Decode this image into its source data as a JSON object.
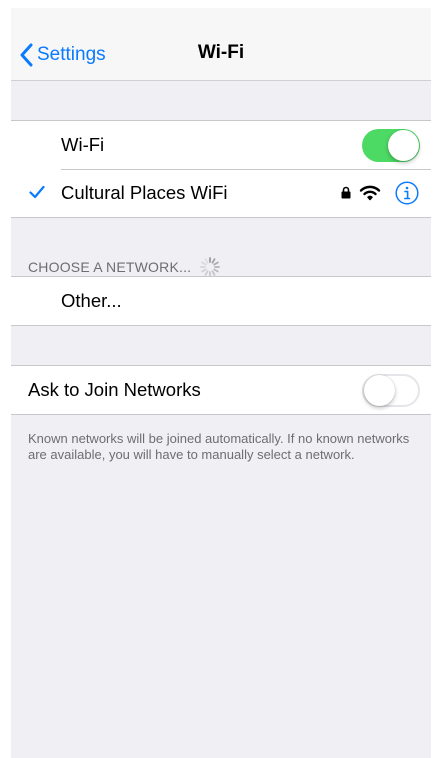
{
  "navbar": {
    "back_label": "Settings",
    "title": "Wi-Fi"
  },
  "wifi_group": {
    "wifi_label": "Wi-Fi",
    "wifi_enabled": true,
    "connected_network": "Cultural Places WiFi",
    "connected_secured": true
  },
  "networks_section": {
    "header": "CHOOSE A NETWORK...",
    "other_label": "Other..."
  },
  "ask_group": {
    "ask_label": "Ask to Join Networks",
    "ask_enabled": false,
    "footer": "Known networks will be joined automatically. If no known networks are available, you will have to manually select a network."
  },
  "colors": {
    "accent": "#0a7aff",
    "toggle_on": "#4cd964",
    "background": "#efeff4"
  }
}
